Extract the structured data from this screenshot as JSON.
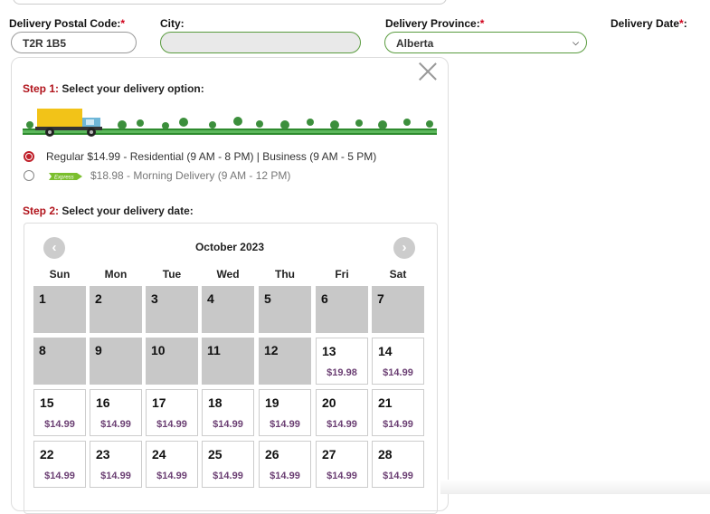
{
  "form": {
    "postal_label": "Delivery Postal Code:",
    "postal_value": "T2R 1B5",
    "city_label": "City:",
    "city_value": "",
    "province_label": "Delivery Province:",
    "province_value": "Alberta",
    "date_label": "Delivery Date",
    "required_mark": "*",
    "date_colon": ":"
  },
  "step1": {
    "prefix": "Step 1:",
    "text": "Select your delivery option:"
  },
  "options": [
    {
      "label": "Regular $14.99 - Residential (9 AM - 8 PM) | Business (9 AM - 5 PM)",
      "selected": true
    },
    {
      "badge": "Express",
      "label": "$18.98 - Morning Delivery (9 AM - 12 PM)",
      "selected": false
    }
  ],
  "step2": {
    "prefix": "Step 2:",
    "text": "Select your delivery date:"
  },
  "calendar": {
    "month": "October 2023",
    "prev_icon": "‹",
    "next_icon": "›",
    "weekdays": [
      "Sun",
      "Mon",
      "Tue",
      "Wed",
      "Thu",
      "Fri",
      "Sat"
    ],
    "weeks": [
      [
        {
          "d": "1",
          "p": ""
        },
        {
          "d": "2",
          "p": ""
        },
        {
          "d": "3",
          "p": ""
        },
        {
          "d": "4",
          "p": ""
        },
        {
          "d": "5",
          "p": ""
        },
        {
          "d": "6",
          "p": ""
        },
        {
          "d": "7",
          "p": ""
        }
      ],
      [
        {
          "d": "8",
          "p": ""
        },
        {
          "d": "9",
          "p": ""
        },
        {
          "d": "10",
          "p": ""
        },
        {
          "d": "11",
          "p": ""
        },
        {
          "d": "12",
          "p": ""
        },
        {
          "d": "13",
          "p": "$19.98"
        },
        {
          "d": "14",
          "p": "$14.99"
        }
      ],
      [
        {
          "d": "15",
          "p": "$14.99"
        },
        {
          "d": "16",
          "p": "$14.99"
        },
        {
          "d": "17",
          "p": "$14.99"
        },
        {
          "d": "18",
          "p": "$14.99"
        },
        {
          "d": "19",
          "p": "$14.99"
        },
        {
          "d": "20",
          "p": "$14.99"
        },
        {
          "d": "21",
          "p": "$14.99"
        }
      ],
      [
        {
          "d": "22",
          "p": "$14.99"
        },
        {
          "d": "23",
          "p": "$14.99"
        },
        {
          "d": "24",
          "p": "$14.99"
        },
        {
          "d": "25",
          "p": "$14.99"
        },
        {
          "d": "26",
          "p": "$14.99"
        },
        {
          "d": "27",
          "p": "$14.99"
        },
        {
          "d": "28",
          "p": "$14.99"
        }
      ]
    ]
  },
  "colors": {
    "required": "#d0021b",
    "accent_green": "#5a9c3f",
    "price": "#6b3f73",
    "disabled_cell": "#c8c8c8"
  }
}
